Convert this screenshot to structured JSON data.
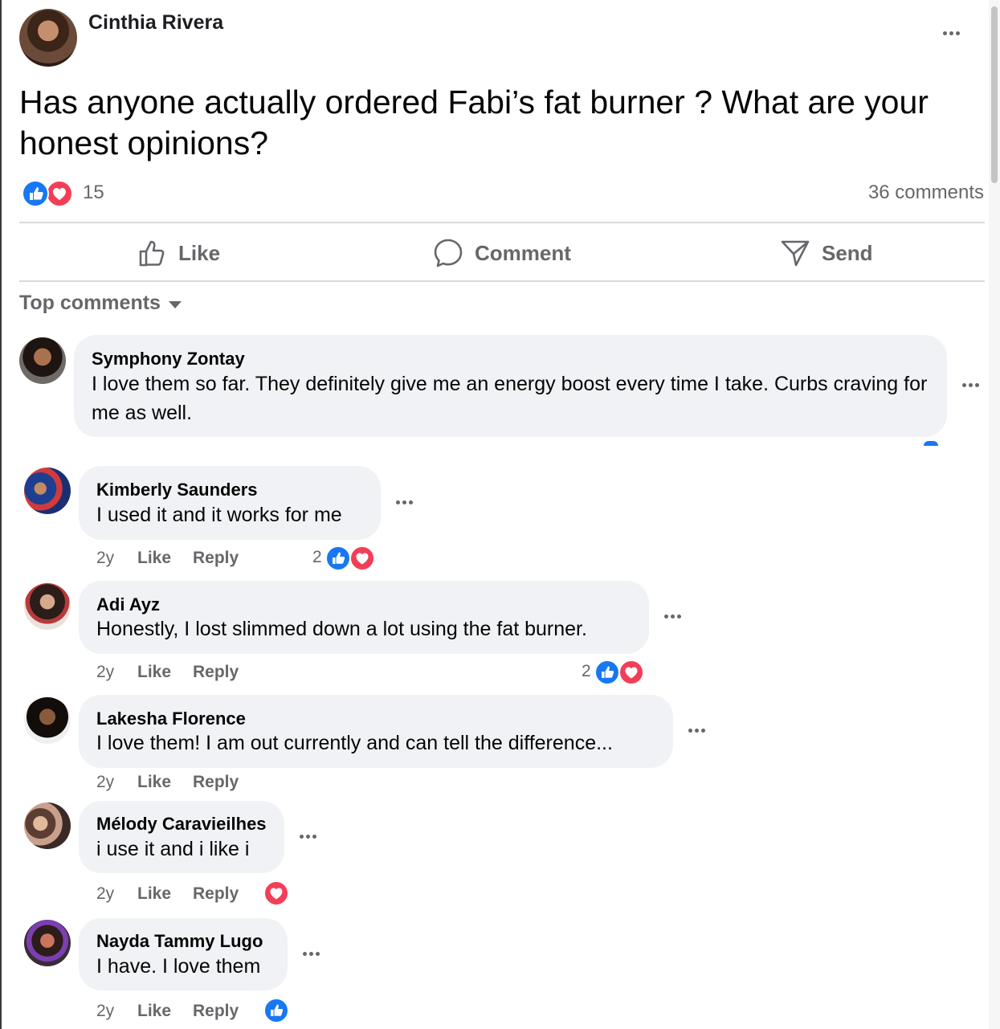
{
  "post": {
    "author": "Cinthia Rivera",
    "text": "Has anyone actually ordered Fabi’s  fat burner ?  What are your honest opinions?",
    "reaction_count": "15",
    "comments_count": "36 comments"
  },
  "actions": {
    "like": "Like",
    "comment": "Comment",
    "send": "Send"
  },
  "sort_label": "Top comments",
  "comments": [
    {
      "name": "Symphony Zontay",
      "text": "I love them so far. They definitely give me an energy boost every time I take. Curbs craving for me as well."
    },
    {
      "name": "Kimberly Saunders",
      "text": "I used it and it works for me",
      "time": "2y",
      "like": "Like",
      "reply": "Reply",
      "reactions": "2"
    },
    {
      "name": "Adi Ayz",
      "text": "Honestly, I lost slimmed down a lot using the fat burner.",
      "time": "2y",
      "like": "Like",
      "reply": "Reply",
      "reactions": "2"
    },
    {
      "name": "Lakesha Florence",
      "text": "I love them! I am out currently and can tell the difference...",
      "time": "2y",
      "like": "Like",
      "reply": "Reply"
    },
    {
      "name": "Mélody Caravieilhes",
      "text": "i use it and i like i",
      "time": "2y",
      "like": "Like",
      "reply": "Reply"
    },
    {
      "name": "Nayda Tammy Lugo",
      "text": "I have. I love them",
      "time": "2y",
      "like": "Like",
      "reply": "Reply"
    }
  ],
  "colors": {
    "facebook_blue": "#1877f2",
    "love_red": "#f33e58",
    "secondary_text": "#65676b",
    "bubble": "#f0f2f5"
  },
  "icons": [
    "more-options-icon",
    "like-reaction-icon",
    "love-reaction-icon",
    "thumbs-up-icon",
    "comment-icon",
    "send-icon",
    "caret-down-icon"
  ]
}
